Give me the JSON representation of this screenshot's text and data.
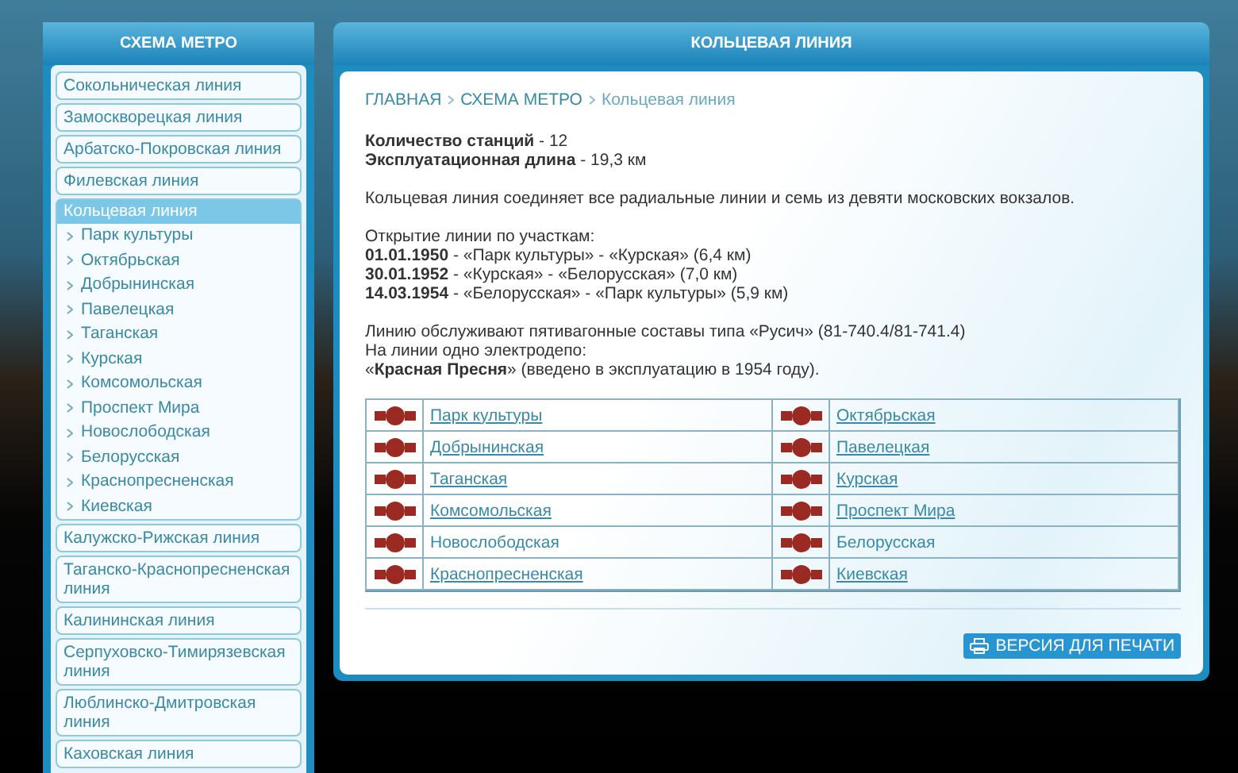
{
  "sidebar": {
    "title": "СХЕМА МЕТРО",
    "items": [
      {
        "label": "Сокольническая линия",
        "selected": false
      },
      {
        "label": "Замоскворецкая линия",
        "selected": false
      },
      {
        "label": "Арбатско-Покровская линия",
        "selected": false
      },
      {
        "label": "Филевская линия",
        "selected": false
      },
      {
        "label": "Кольцевая линия",
        "selected": true,
        "children": [
          "Парк культуры",
          "Октябрьская",
          "Добрынинская",
          "Павелецкая",
          "Таганская",
          "Курская",
          "Комсомольская",
          "Проспект Мира",
          "Новослободская",
          "Белорусская",
          "Краснопресненская",
          "Киевская"
        ]
      },
      {
        "label": "Калужско-Рижская линия",
        "selected": false
      },
      {
        "label": "Таганско-Краснопресненская линия",
        "selected": false
      },
      {
        "label": "Калининская линия",
        "selected": false
      },
      {
        "label": "Серпуховско-Тимирязевская линия",
        "selected": false
      },
      {
        "label": "Люблинско-Дмитровская линия",
        "selected": false
      },
      {
        "label": "Каховская линия",
        "selected": false
      }
    ]
  },
  "main": {
    "title": "КОЛЬЦЕВАЯ ЛИНИЯ",
    "breadcrumb": [
      {
        "label": "ГЛАВНАЯ",
        "link": true
      },
      {
        "label": "СХЕМА МЕТРО",
        "link": true
      },
      {
        "label": "Кольцевая линия",
        "link": false
      }
    ],
    "paragraphs": [
      [
        "**Количество станций** - 12",
        "**Эксплуатационная длина** - 19,3 км"
      ],
      [
        "Кольцевая линия соединяет все радиальные линии и семь из девяти московских вокзалов."
      ],
      [
        "Открытие линии по участкам:",
        "**01.01.1950** - «Парк культуры» - «Курская» (6,4 км)",
        "**30.01.1952** - «Курская» - «Белорусская» (7,0 км)",
        "**14.03.1954** - «Белорусская» - «Парк культуры» (5,9 км)"
      ],
      [
        "Линию обслуживают пятивагонные составы типа «Русич» (81-740.4/81-741.4)",
        "На линии одно электродепо:",
        "«**Красная Пресня**» (введено в эксплуатацию в 1954 году)."
      ]
    ],
    "stations": [
      {
        "name": "Парк культуры",
        "link": true
      },
      {
        "name": "Октябрьская",
        "link": true
      },
      {
        "name": "Добрынинская",
        "link": true
      },
      {
        "name": "Павелецкая",
        "link": true
      },
      {
        "name": "Таганская",
        "link": true
      },
      {
        "name": "Курская",
        "link": true
      },
      {
        "name": "Комсомольская",
        "link": true
      },
      {
        "name": "Проспект Мира",
        "link": true
      },
      {
        "name": "Новослободская",
        "link": false
      },
      {
        "name": "Белорусская",
        "link": false
      },
      {
        "name": "Краснопресненская",
        "link": true
      },
      {
        "name": "Киевская",
        "link": true
      }
    ],
    "print_button": "ВЕРСИЯ ДЛЯ ПЕЧАТИ"
  }
}
